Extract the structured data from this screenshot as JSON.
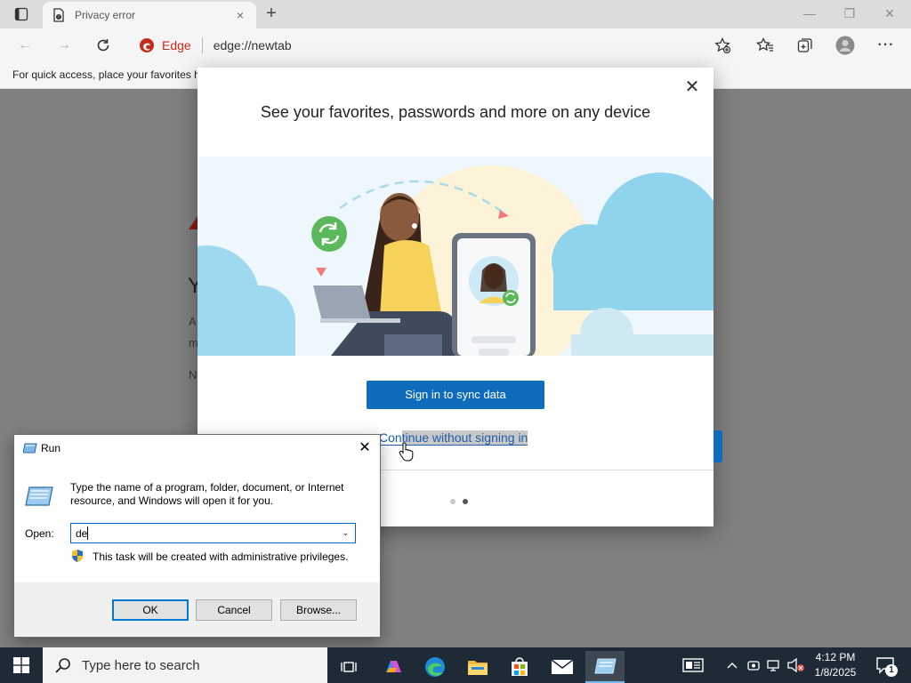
{
  "browser": {
    "tab_title": "Privacy error",
    "tab_close": "×",
    "new_tab": "+",
    "site_name": "Edge",
    "url": "edge://newtab",
    "favorites_bar_message": "For quick access, place your favorites h",
    "window_controls": {
      "minimize": "—",
      "restore": "❐",
      "close": "✕"
    }
  },
  "page_fragments": {
    "heading_initial": "Y",
    "line1": "A",
    "line2": "m",
    "line3": "N"
  },
  "sync_dialog": {
    "close": "✕",
    "heading": "See your favorites, passwords and more on any device",
    "signin_button": "Sign in to sync data",
    "continue_prefix": "Con",
    "continue_highlighted": "tinue without signing in",
    "pager_dots": 2,
    "active_dot": 2,
    "colors": {
      "accent": "#0f6cbd",
      "sync_green": "#5cb85c",
      "sky": "#8dd4ea",
      "shirt": "#f7d25a"
    }
  },
  "run_dialog": {
    "title": "Run",
    "close": "✕",
    "description": "Type the name of a program, folder, document, or Internet resource, and Windows will open it for you.",
    "open_label": "Open:",
    "open_value": "de",
    "admin_note": "This task will be created with administrative privileges.",
    "ok_label": "OK",
    "cancel_label": "Cancel",
    "browse_label": "Browse..."
  },
  "taskbar": {
    "search_placeholder": "Type here to search",
    "time": "4:12 PM",
    "date": "1/8/2025",
    "notification_count": "1"
  }
}
